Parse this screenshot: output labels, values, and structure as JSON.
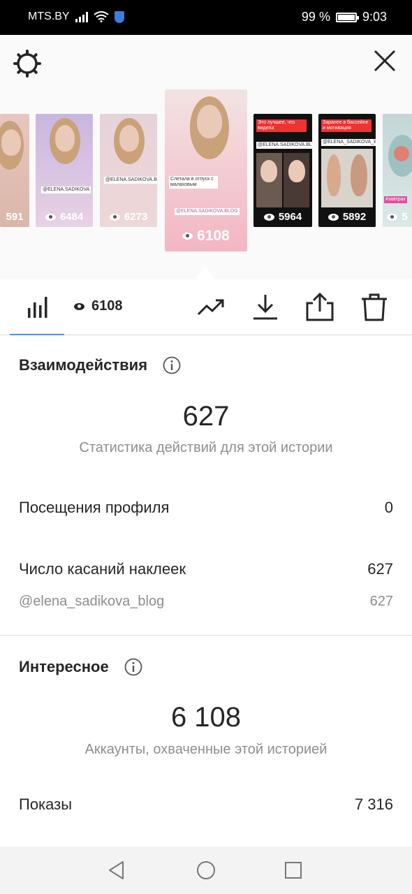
{
  "status_bar": {
    "carrier": "MTS.BY",
    "battery": "99 %",
    "time": "9:03"
  },
  "top": {
    "settings_icon": "settings-icon",
    "close_icon": "close-icon"
  },
  "stories": [
    {
      "views": "591",
      "colors": [
        "#e8c5c0",
        "#d9b7a8"
      ]
    },
    {
      "views": "6484",
      "colors": [
        "#c8b6e0",
        "#e8d2e4"
      ]
    },
    {
      "views": "6273",
      "colors": [
        "#e5d3da",
        "#eed7d8"
      ]
    },
    {
      "views": "6108",
      "colors": [
        "#efcfd2",
        "#f3b6c3"
      ],
      "label1": "Слетала в отпуск с малаховым",
      "label2": "@ELENA.SADIKOVA.BLOG"
    },
    {
      "views": "5964",
      "colors": [
        "#101010",
        "#2a2a2a"
      ],
      "label1": "Это лучшее, что видела",
      "label2": "@ELENA.SADIKOVA.BLOG"
    },
    {
      "views": "5892",
      "colors": [
        "#111111",
        "#2a2a2a"
      ],
      "label1": "Заранее в бассейне и мотивация",
      "label2": "@ELENA_SADIKOVA_BLOG"
    },
    {
      "views": "5",
      "colors": [
        "#c3d6d6",
        "#dce8e6"
      ],
      "label1": "#завтрак"
    }
  ],
  "tabs": {
    "views_count": "6108"
  },
  "interactions": {
    "title": "Взаимодействия",
    "total": "627",
    "caption": "Статистика действий для этой истории",
    "profile_visits_label": "Посещения профиля",
    "profile_visits_value": "0",
    "sticker_taps_label": "Число касаний наклеек",
    "sticker_taps_value": "627",
    "mention_label": "@elena_sadikova_blog",
    "mention_value": "627"
  },
  "discovery": {
    "title": "Интересное",
    "total": "6 108",
    "caption": "Аккаунты, охваченные этой историей",
    "impressions_label": "Показы",
    "impressions_value": "7 316"
  }
}
